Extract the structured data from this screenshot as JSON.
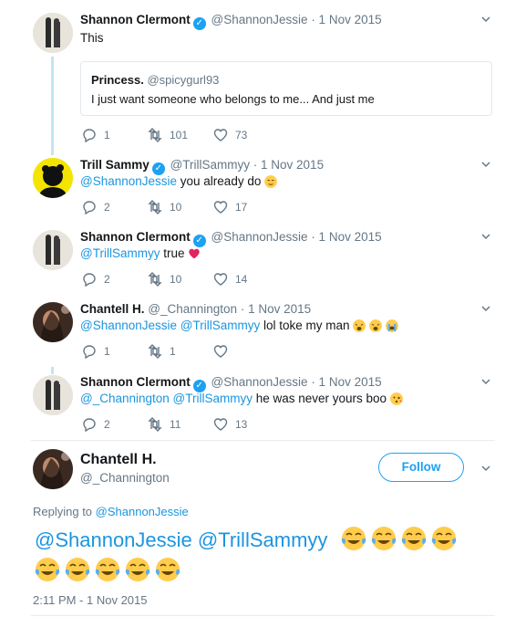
{
  "tweets": [
    {
      "name": "Shannon Clermont",
      "handle": "@ShannonJessie",
      "date": "· 1 Nov 2015",
      "text": "This",
      "quote": {
        "name": "Princess.",
        "handle": "@spicygurl93",
        "text": "I just want someone who belongs to me... And just me"
      },
      "replies": "1",
      "retweets": "101",
      "likes": "73"
    },
    {
      "name": "Trill Sammy",
      "handle": "@TrillSammyy",
      "date": "· 1 Nov 2015",
      "mentions": "@ShannonJessie",
      "text": " you already do ",
      "replies": "2",
      "retweets": "10",
      "likes": "17"
    },
    {
      "name": "Shannon Clermont",
      "handle": "@ShannonJessie",
      "date": "· 1 Nov 2015",
      "mentions": "@TrillSammyy",
      "text": " true ",
      "replies": "2",
      "retweets": "10",
      "likes": "14"
    },
    {
      "name": "Chantell H.",
      "handle": "@_Channington",
      "date": "· 1 Nov 2015",
      "mentions": "@ShannonJessie @TrillSammyy",
      "text": " lol toke my man ",
      "replies": "1",
      "retweets": "1",
      "likes": ""
    },
    {
      "name": "Shannon Clermont",
      "handle": "@ShannonJessie",
      "date": "· 1 Nov 2015",
      "mentions": "@_Channington @TrillSammyy",
      "text": "  he was never yours boo ",
      "replies": "2",
      "retweets": "11",
      "likes": "13"
    }
  ],
  "main": {
    "name": "Chantell H.",
    "handle": "@_Channington",
    "follow_label": "Follow",
    "replying_prefix": "Replying to ",
    "replying_to": "@ShannonJessie",
    "mentions": "@ShannonJessie @TrillSammyy",
    "timestamp": "2:11 PM - 1 Nov 2015"
  },
  "icons": [
    "reply-icon",
    "retweet-icon",
    "like-icon",
    "verified-badge-icon",
    "chevron-down-icon",
    "emoji-relieved",
    "emoji-heart",
    "emoji-weary",
    "emoji-crying",
    "emoji-kiss",
    "emoji-tears-of-joy"
  ],
  "colors": {
    "accent": "#1da1f2",
    "mention": "#1b95e0",
    "muted": "#657786",
    "thread": "#c4e4f5",
    "heart": "#e0245e"
  }
}
